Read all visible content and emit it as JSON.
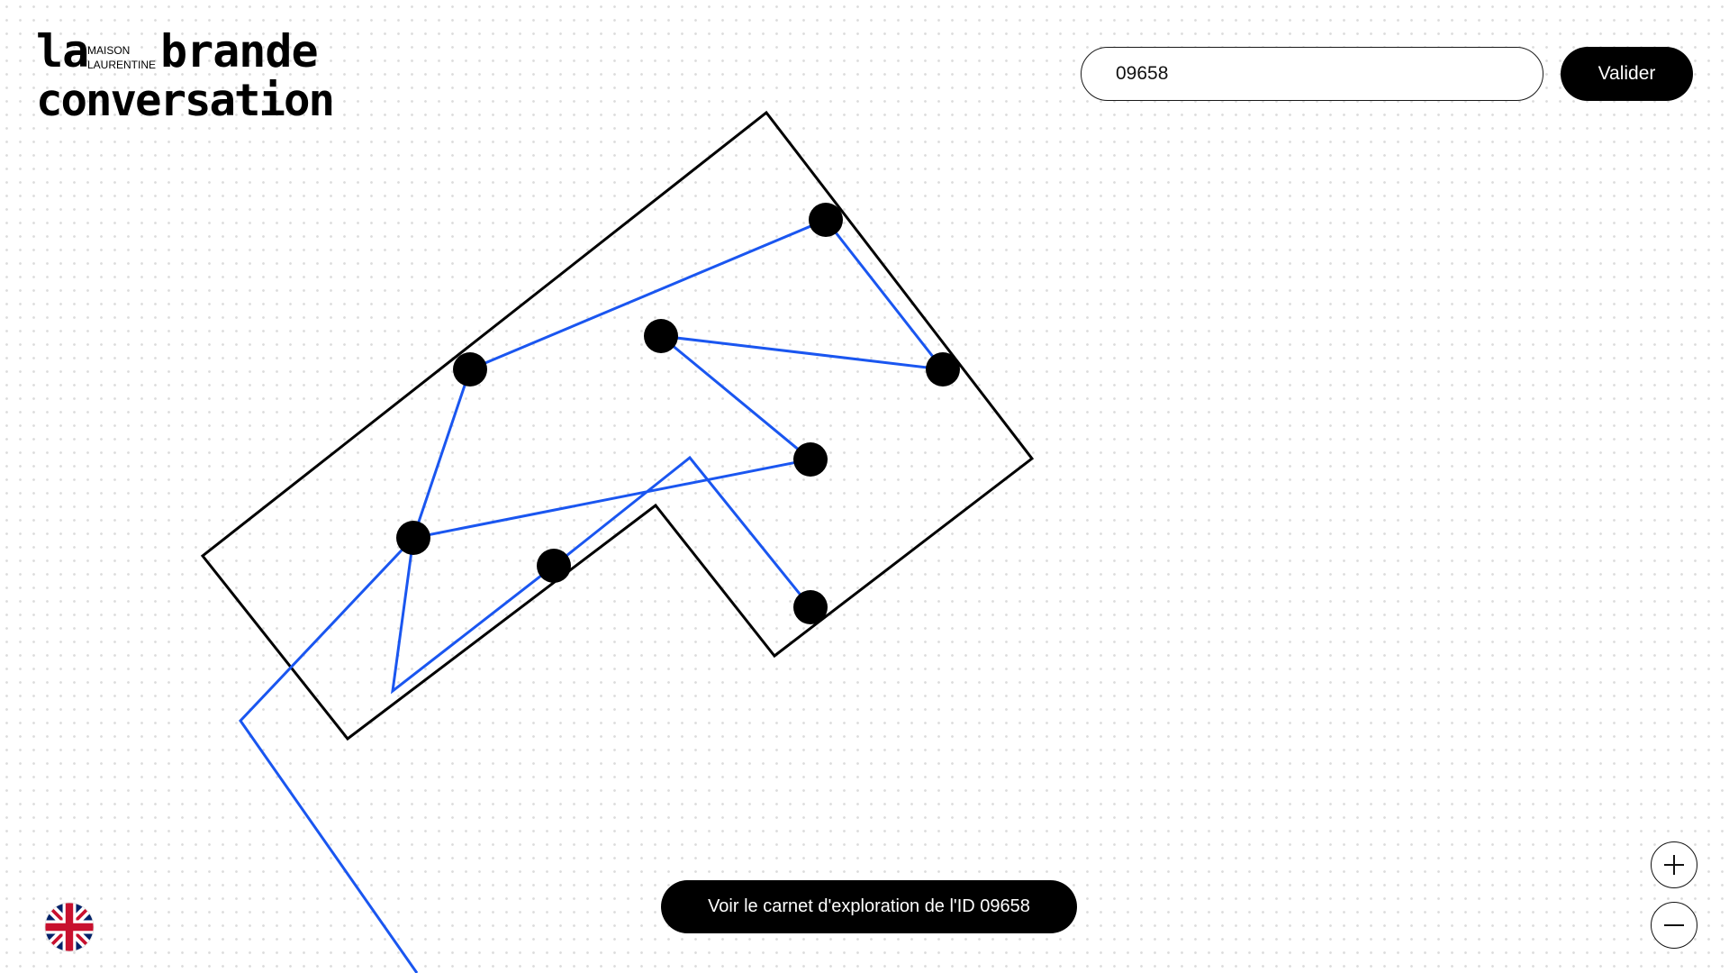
{
  "brand": {
    "la": "la",
    "maison": "MAISON",
    "laurentine": "LAURENTINE",
    "brande": "brande",
    "conversation": "conversation"
  },
  "search": {
    "value": "09658",
    "button_label": "Valider"
  },
  "cta": {
    "label": "Voir le carnet d'exploration de l'ID 09658"
  },
  "language": {
    "icon": "uk-flag-icon"
  },
  "zoom": {
    "in_icon": "plus-icon",
    "out_icon": "minus-icon"
  },
  "colors": {
    "network_line": "#1a56f0",
    "outline": "#000000",
    "node": "#000000"
  }
}
